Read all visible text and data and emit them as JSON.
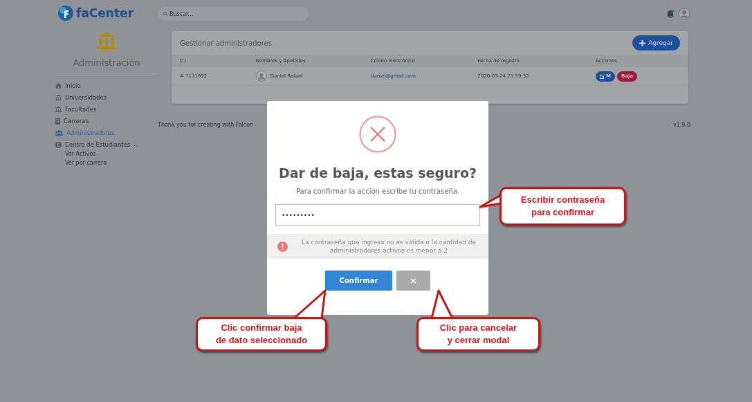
{
  "brand": {
    "name": "faCenter"
  },
  "sidebar": {
    "title": "Administración",
    "items": [
      {
        "label": "Inicio",
        "selected": false
      },
      {
        "label": "Universidades",
        "selected": false
      },
      {
        "label": "Facultades",
        "selected": false
      },
      {
        "label": "Carreras",
        "selected": false
      },
      {
        "label": "Administradores",
        "selected": true
      },
      {
        "label": "Centro de Estudiantes",
        "selected": false,
        "expanded": true,
        "children": [
          {
            "label": "Ver Activos"
          },
          {
            "label": "Ver por carrera"
          }
        ]
      }
    ]
  },
  "search": {
    "placeholder": "Buscar..."
  },
  "card": {
    "title": "Gestionar administradores",
    "add_button": "Agregar",
    "table": {
      "columns": [
        "C.I.",
        "Nombres y Apellidos",
        "Correo electrónico",
        "Fecha de registro",
        "Acciones"
      ],
      "rows": [
        {
          "ci": "# 7111692",
          "name": "Daniel Rafael",
          "email": "daniel@gmail.com",
          "date": "2020-03-24 21:59:32",
          "edit": "M",
          "delete": "Baja"
        }
      ]
    }
  },
  "footer": {
    "text": "Thank you for creating with Falcon",
    "version": "v1.9.0"
  },
  "modal": {
    "title": "Dar de baja, estas seguro?",
    "message": "Para confirmar la accion escribe tu contraseña.",
    "password_value": "•••••••••",
    "error": "La contraseña que ingreso no es válida o la cantidad de administradores activos es menor a 2",
    "confirm_button": "Confirmar",
    "cancel_button": "×"
  },
  "callouts": [
    {
      "text": "Escribir contraseña\npara confirmar"
    },
    {
      "text": "Clic confirmar baja\nde dato seleccionado"
    },
    {
      "text": "Clic para cancelar\ny cerrar modal"
    }
  ]
}
